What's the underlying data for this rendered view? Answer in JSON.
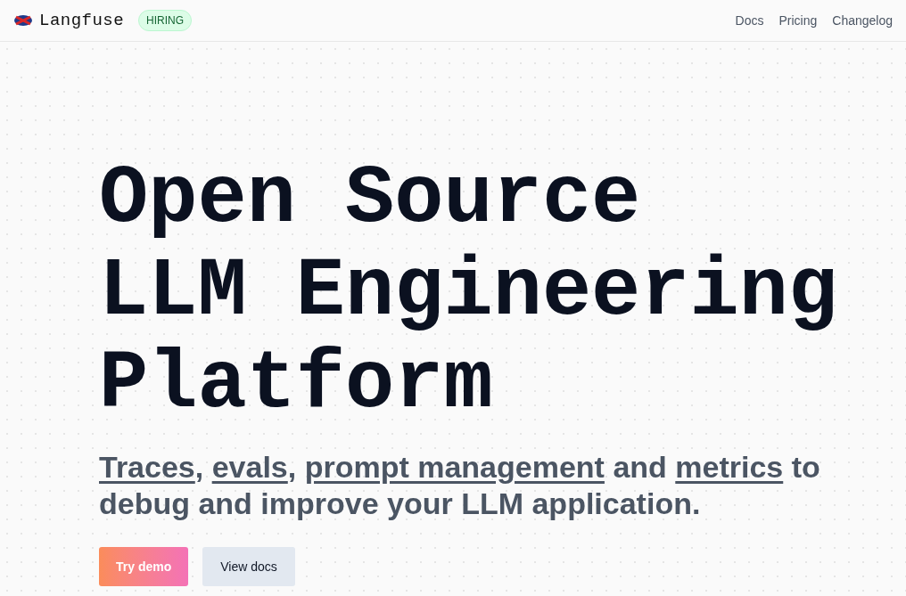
{
  "header": {
    "brand": "Langfuse",
    "badge": "HIRING",
    "nav": [
      "Docs",
      "Pricing",
      "Changelog"
    ]
  },
  "hero": {
    "headline": [
      "Open Source",
      "LLM Engineering",
      "Platform"
    ],
    "subtitle": [
      {
        "kind": "link",
        "text": "Traces"
      },
      {
        "kind": "text",
        "text": ", "
      },
      {
        "kind": "link",
        "text": "evals"
      },
      {
        "kind": "text",
        "text": ", "
      },
      {
        "kind": "link",
        "text": "prompt management"
      },
      {
        "kind": "text",
        "text": " and "
      },
      {
        "kind": "link",
        "text": "metrics"
      },
      {
        "kind": "text",
        "text": " to debug and improve your LLM application."
      }
    ],
    "buttons": [
      {
        "kind": "primary",
        "label": "Try demo"
      },
      {
        "kind": "secondary",
        "label": "View docs"
      }
    ]
  }
}
